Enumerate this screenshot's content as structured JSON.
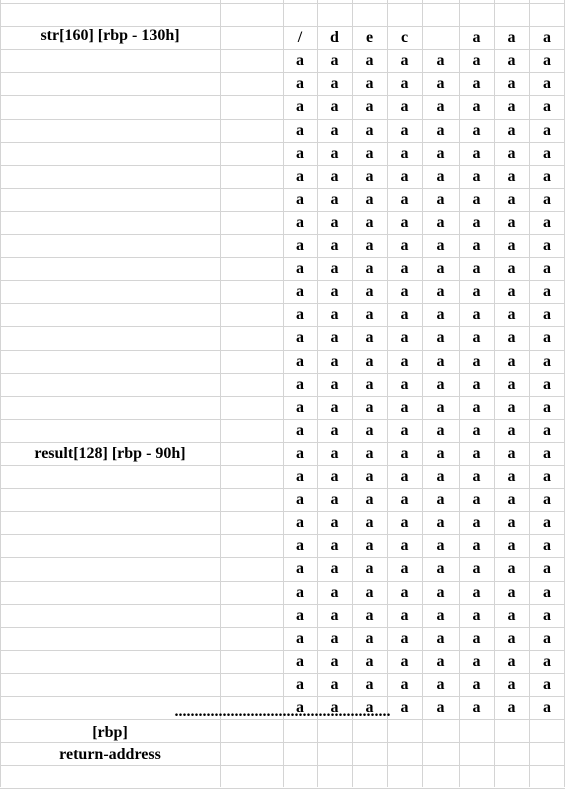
{
  "labels": {
    "str": "str[160] [rbp - 130h]",
    "result": "result[128] [rbp - 90h]",
    "dots": "......................................................",
    "rbp": "[rbp]",
    "ret": "return-address"
  },
  "first_row": [
    "/",
    "d",
    "e",
    "c",
    "",
    "a",
    "a",
    "a"
  ],
  "fill_char": "a",
  "filled_rows": 29
}
